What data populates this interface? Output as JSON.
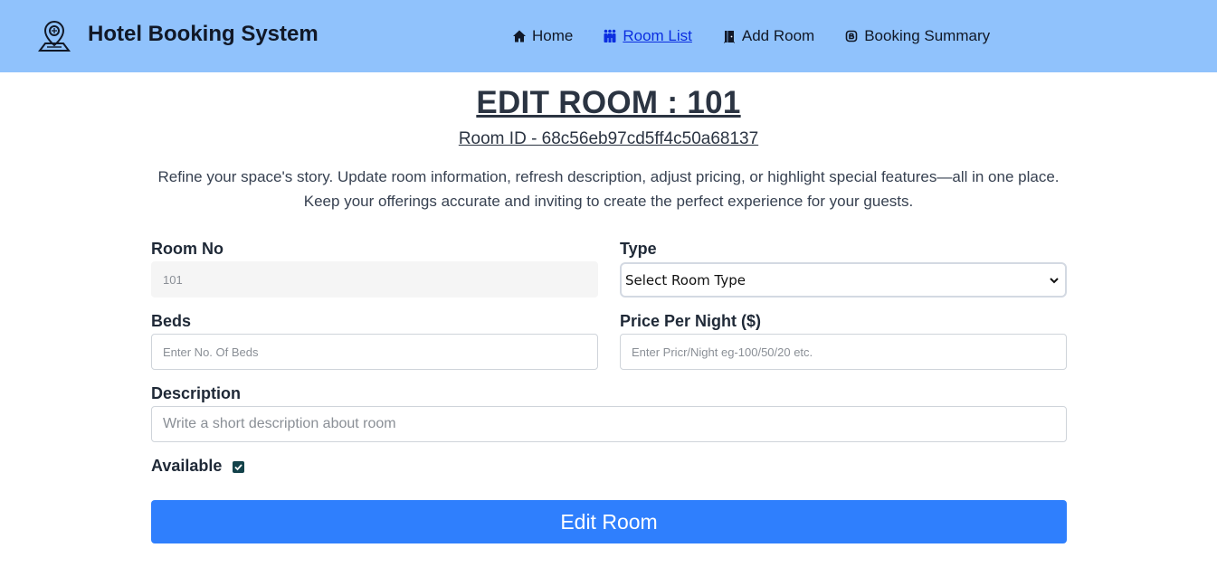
{
  "header": {
    "title": "Hotel Booking System",
    "logo_icon": "hotel-location-icon",
    "nav": [
      {
        "label": "Home",
        "icon": "home-icon",
        "active": false
      },
      {
        "label": "Room List",
        "icon": "people-icon",
        "active": true
      },
      {
        "label": "Add Room",
        "icon": "door-icon",
        "active": false
      },
      {
        "label": "Booking Summary",
        "icon": "receipt-icon",
        "active": false
      }
    ]
  },
  "page": {
    "title": "EDIT ROOM : 101",
    "room_id": "Room ID - 68c56eb97cd5ff4c50a68137",
    "intro": "Refine your space's story. Update room information, refresh description, adjust pricing, or highlight special features—all in one place. Keep your offerings accurate and inviting to create the perfect experience for your guests."
  },
  "form": {
    "room_no": {
      "label": "Room No",
      "value": "101"
    },
    "type": {
      "label": "Type",
      "selected": "Select Room Type"
    },
    "beds": {
      "label": "Beds",
      "placeholder": "Enter No. Of Beds"
    },
    "price": {
      "label": "Price Per Night ($)",
      "placeholder": "Enter Pricr/Night eg-100/50/20 etc."
    },
    "description": {
      "label": "Description",
      "placeholder": "Write a short description about room"
    },
    "available": {
      "label": "Available",
      "checked": true
    },
    "submit_label": "Edit Room"
  },
  "colors": {
    "navbar": "#90c2fc",
    "active_link": "#0b2ee0",
    "button": "#2f7ffd",
    "checkbox": "#13424a"
  }
}
